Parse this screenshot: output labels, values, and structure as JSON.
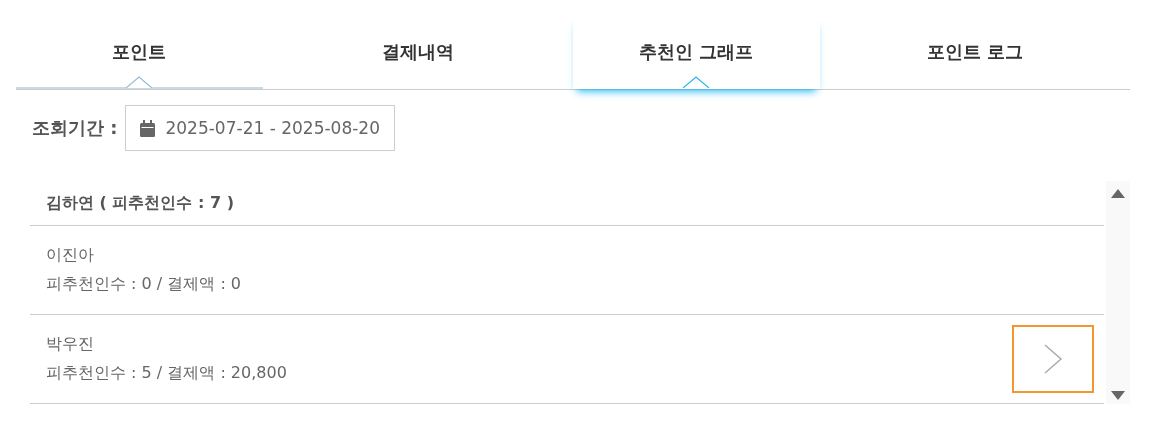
{
  "tabs": [
    {
      "label": "포인트",
      "selected": false,
      "hovered": true
    },
    {
      "label": "결제내역",
      "selected": false,
      "hovered": false
    },
    {
      "label": "추천인 그래프",
      "selected": true,
      "hovered": false
    },
    {
      "label": "포인트 로그",
      "selected": false,
      "hovered": false
    }
  ],
  "period": {
    "label": "조회기간 :",
    "value": "2025-07-21 - 2025-08-20"
  },
  "list": {
    "header": "김하연 ( 피추천인수 : 7 )",
    "rows": [
      {
        "name": "이진아",
        "detail": "피추천인수 : 0 / 결제액 : 0",
        "has_next": false
      },
      {
        "name": "박우진",
        "detail": "피추천인수 : 5 / 결제액 : 20,800",
        "has_next": true
      }
    ]
  }
}
